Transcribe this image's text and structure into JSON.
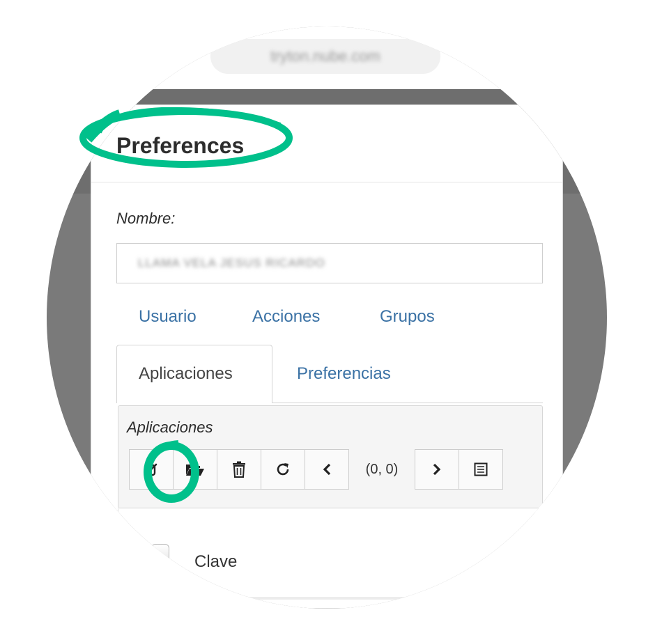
{
  "browser": {
    "url": "tryton.nube.com"
  },
  "dialog": {
    "title": "Preferences",
    "name_label": "Nombre:",
    "name_value": "LLAMA VELA JESUS RICARDO",
    "top_tabs": [
      "Usuario",
      "Acciones",
      "Grupos"
    ],
    "sub_tabs": [
      "Aplicaciones",
      "Preferencias"
    ],
    "active_sub_tab": "Aplicaciones",
    "panel_title": "Aplicaciones",
    "toolbar": {
      "buttons": [
        "edit-icon",
        "folder-open-icon",
        "trash-icon",
        "refresh-icon",
        "chevron-left-icon",
        "chevron-right-icon",
        "list-icon"
      ],
      "record_count": "(0, 0)"
    },
    "checkbox_label": "Clave"
  },
  "colors": {
    "highlight": "#00c08b",
    "link": "#3b72a5",
    "backdrop": "#7a7a7a"
  }
}
